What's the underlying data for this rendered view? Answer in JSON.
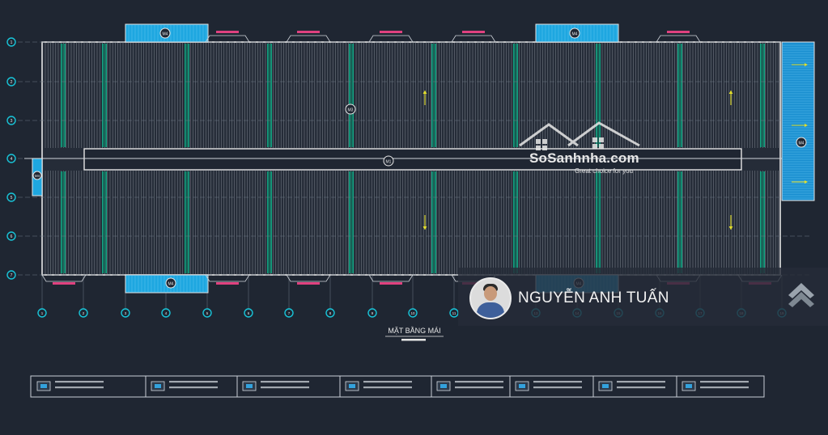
{
  "drawing": {
    "title": "MẶT BẰNG MÁI",
    "center_tag": "M3",
    "ridge_tag": "M1",
    "skylight_tag": "M4",
    "top_vent_tags": [
      "M4",
      "M4"
    ],
    "bottom_vent_tags": [
      "M4",
      "M4"
    ],
    "left_tag": "M4",
    "right_tag": "M4",
    "row_axes": [
      "1",
      "2",
      "3",
      "4",
      "5",
      "6",
      "7"
    ],
    "column_axes": [
      "1",
      "2",
      "3",
      "4",
      "5",
      "6",
      "7",
      "8",
      "9",
      "10",
      "11",
      "12",
      "13",
      "14",
      "15",
      "16",
      "17",
      "18",
      "19"
    ],
    "colors": {
      "background": "#1f2632",
      "outline": "#e6e6e6",
      "grid": "#6f7885",
      "purlin": "#10b58e",
      "vent": "#1ea7e0",
      "pink": "#e0417f",
      "arrow": "#e5e02a",
      "axis_circle": "#18c4d8"
    }
  },
  "watermark": {
    "brand": "SoSanhnha.com",
    "slogan": "Great choice for you"
  },
  "author": {
    "name": "NGUYỄN ANH TUẤN"
  },
  "legend": {
    "items": [
      {
        "icon": "notes-icon"
      },
      {
        "icon": "roof-sheet-icon"
      },
      {
        "icon": "purlin-icon"
      },
      {
        "icon": "skylight-icon"
      },
      {
        "icon": "vent-icon"
      },
      {
        "icon": "gutter-icon"
      },
      {
        "icon": "downpipe-icon"
      },
      {
        "icon": "ridge-icon"
      }
    ]
  }
}
